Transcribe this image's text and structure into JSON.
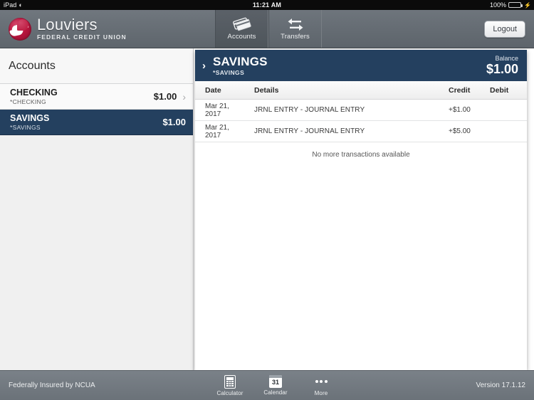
{
  "statusbar": {
    "device": "iPad",
    "wifi_icon": "wifi-icon",
    "time": "11:21 AM",
    "battery_percent": "100%",
    "battery_icon": "battery-full-charging-icon"
  },
  "brand": {
    "name": "Louviers",
    "subtitle": "FEDERAL CREDIT UNION",
    "logo_icon": "louviers-logo-icon",
    "logo_color": "#b81339"
  },
  "nav": {
    "tabs": [
      {
        "label": "Accounts",
        "icon": "credit-cards-icon",
        "active": true
      },
      {
        "label": "Transfers",
        "icon": "transfer-arrows-icon",
        "active": false
      }
    ],
    "logout_label": "Logout"
  },
  "sidebar": {
    "title": "Accounts",
    "accounts": [
      {
        "name": "CHECKING",
        "sub": "*CHECKING",
        "balance": "$1.00",
        "chevron_icon": "chevron-right-icon",
        "selected": false
      },
      {
        "name": "SAVINGS",
        "sub": "*SAVINGS",
        "balance": "$1.00",
        "selected": true
      }
    ]
  },
  "main": {
    "header": {
      "chevron_icon": "chevron-right-icon",
      "title": "SAVINGS",
      "sub": "*SAVINGS",
      "balance_label": "Balance",
      "balance_value": "$1.00",
      "background_color": "#24405f"
    },
    "columns": [
      "Date",
      "Details",
      "Credit",
      "Debit"
    ],
    "transactions": [
      {
        "date": "Mar 21, 2017",
        "details": "JRNL ENTRY - JOURNAL ENTRY",
        "credit": "+$1.00",
        "debit": ""
      },
      {
        "date": "Mar 21, 2017",
        "details": "JRNL ENTRY - JOURNAL ENTRY",
        "credit": "+$5.00",
        "debit": ""
      }
    ],
    "end_of_list": "No more transactions available"
  },
  "footer": {
    "insured_text": "Federally Insured by NCUA",
    "tabs": [
      {
        "label": "Calculator",
        "icon": "calculator-icon"
      },
      {
        "label": "Calendar",
        "icon": "calendar-icon",
        "day": "31"
      },
      {
        "label": "More",
        "icon": "ellipsis-icon"
      }
    ],
    "version": "Version 17.1.12"
  }
}
